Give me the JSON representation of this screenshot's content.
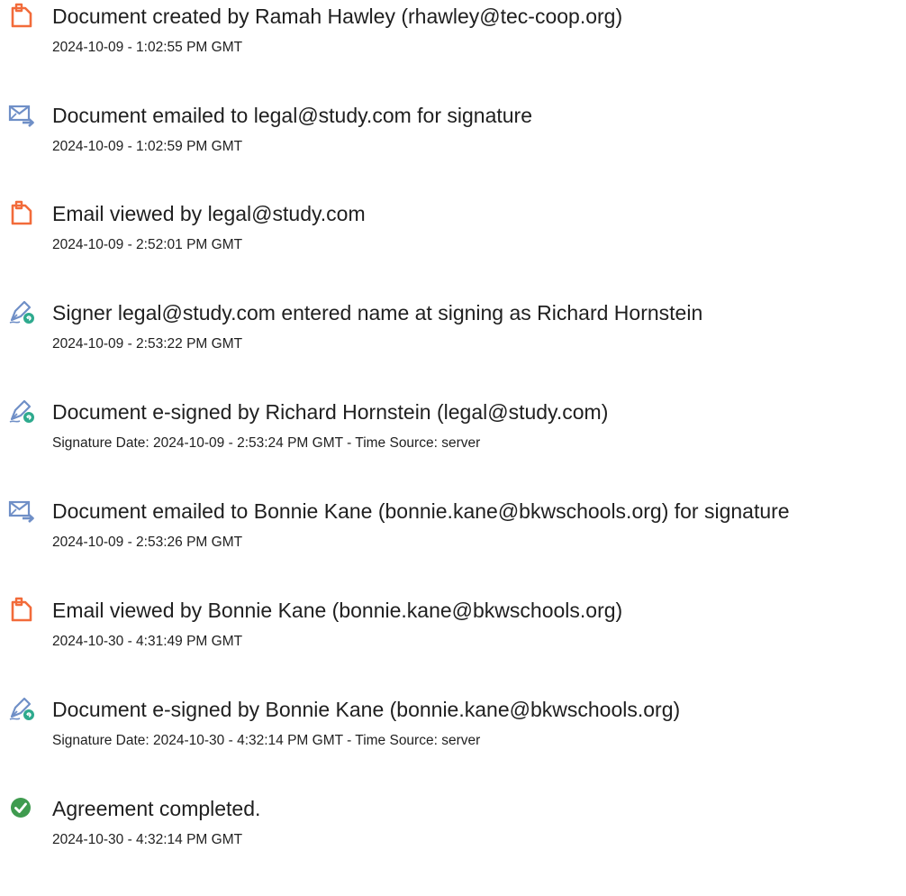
{
  "audit_log": {
    "entries": [
      {
        "icon": "document-created-icon",
        "title": "Document created by Ramah Hawley (rhawley@tec-coop.org)",
        "detail": "2024-10-09 - 1:02:55 PM GMT"
      },
      {
        "icon": "email-sent-icon",
        "title": "Document emailed to legal@study.com for signature",
        "detail": "2024-10-09 - 1:02:59 PM GMT"
      },
      {
        "icon": "document-viewed-icon",
        "title": "Email viewed by legal@study.com",
        "detail": "2024-10-09 - 2:52:01 PM GMT"
      },
      {
        "icon": "pen-sign-icon",
        "title": "Signer legal@study.com entered name at signing as Richard Hornstein",
        "detail": "2024-10-09 - 2:53:22 PM GMT"
      },
      {
        "icon": "pen-sign-icon",
        "title": "Document e-signed by Richard Hornstein (legal@study.com)",
        "detail": "Signature Date: 2024-10-09 - 2:53:24 PM GMT - Time Source: server"
      },
      {
        "icon": "email-sent-icon",
        "title": "Document emailed to Bonnie Kane (bonnie.kane@bkwschools.org) for signature",
        "detail": "2024-10-09 - 2:53:26 PM GMT"
      },
      {
        "icon": "document-viewed-icon",
        "title": "Email viewed by Bonnie Kane (bonnie.kane@bkwschools.org)",
        "detail": "2024-10-30 - 4:31:49 PM GMT"
      },
      {
        "icon": "pen-sign-icon",
        "title": "Document e-signed by Bonnie Kane (bonnie.kane@bkwschools.org)",
        "detail": "Signature Date: 2024-10-30 - 4:32:14 PM GMT - Time Source: server"
      },
      {
        "icon": "check-circle-icon",
        "title": "Agreement completed.",
        "detail": "2024-10-30 - 4:32:14 PM GMT"
      }
    ]
  },
  "colors": {
    "document_icon": "#f26b3a",
    "email_icon": "#6f8fc7",
    "pen_icon": "#6f8fc7",
    "pen_badge": "#2eaa8e",
    "check_icon": "#3f9b4f"
  }
}
